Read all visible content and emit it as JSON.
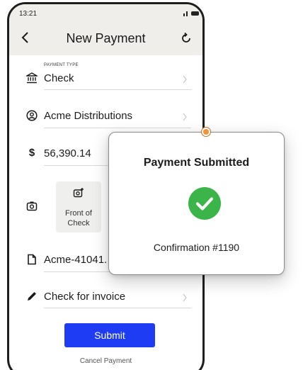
{
  "status_bar": {
    "time": "13:21"
  },
  "header": {
    "title": "New Payment"
  },
  "fields": {
    "payment_type": {
      "caption": "PAYMENT TYPE",
      "value": "Check"
    },
    "payee": {
      "value": "Acme Distributions"
    },
    "amount": {
      "value": "56,390.14"
    },
    "front_of_check": {
      "label_line1": "Front of",
      "label_line2": "Check"
    },
    "document": {
      "value": "Acme-41041."
    },
    "memo": {
      "value": "Check for invoice"
    }
  },
  "actions": {
    "submit_label": "Submit",
    "cancel_label": "Cancel Payment"
  },
  "popup": {
    "title": "Payment Submitted",
    "confirmation": "Confirmation #1190"
  },
  "colors": {
    "accent": "#1f3cf5",
    "success": "#3bb54a",
    "marker": "#f2913a"
  },
  "icons": [
    "back-icon",
    "refresh-icon",
    "bank-icon",
    "user-icon",
    "dollar-icon",
    "camera-icon",
    "document-icon",
    "pencil-icon",
    "checkmark-icon"
  ]
}
